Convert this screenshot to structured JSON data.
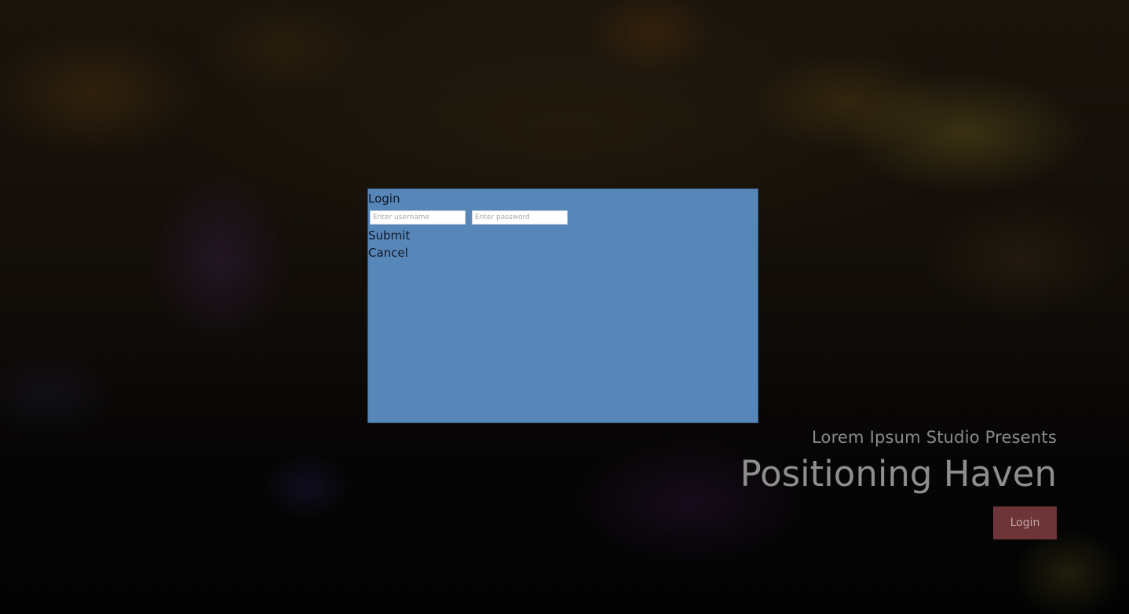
{
  "login_dialog": {
    "title": "Login",
    "username_placeholder": "Enter username",
    "password_placeholder": "Enter password",
    "submit_label": "Submit",
    "cancel_label": "Cancel"
  },
  "hero": {
    "subtitle": "Lorem Ipsum Studio Presents",
    "title": "Positioning Haven",
    "login_label": "Login"
  },
  "colors": {
    "dialog_background": "#5787b9",
    "login_button": "#6e3538"
  }
}
